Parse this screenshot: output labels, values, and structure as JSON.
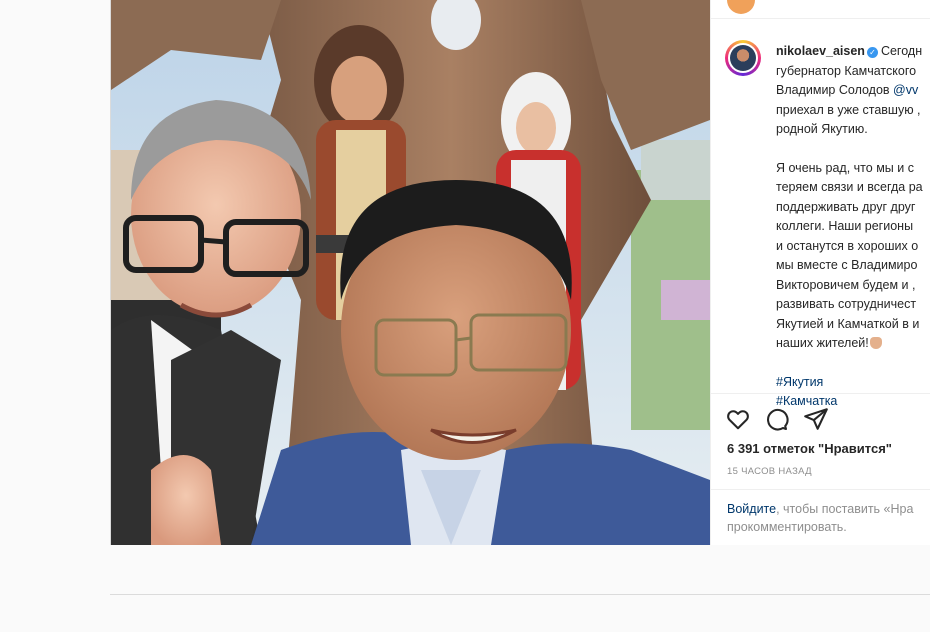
{
  "post": {
    "username": "nikolaev_aisen",
    "caption_lines_1": [
      "Сегодн",
      "губернатор Камчатского",
      "Владимир Солодов"
    ],
    "mention": "@vv",
    "caption_lines_2": [
      "приехал в уже ставшую ,",
      "родной Якутию."
    ],
    "caption_lines_3": [
      "Я очень рад, что мы и с",
      "теряем связи и всегда ра",
      "поддерживать друг друг",
      "коллеги. Наши регионы",
      "и останутся в хороших о",
      "мы вместе с Владимиро",
      "Викторовичем будем и ,",
      "развивать сотрудничест",
      "Якутией и Камчаткой в и",
      "наших жителей!"
    ],
    "hashtags": [
      "#Якутия",
      "#Камчатка"
    ],
    "likes": "6 391 отметок \"Нравится\"",
    "time": "15 ЧАСОВ НАЗАД",
    "login_link": "Войдите",
    "login_text_1": ", чтобы поставить «Нра",
    "login_text_2": "прокомментировать."
  },
  "icons": [
    "heart-icon",
    "comment-icon",
    "share-icon",
    "verified-badge-icon"
  ],
  "colors": {
    "link": "#00376b",
    "muted": "#8e8e8e",
    "verified": "#3897f0",
    "text": "#262626"
  }
}
